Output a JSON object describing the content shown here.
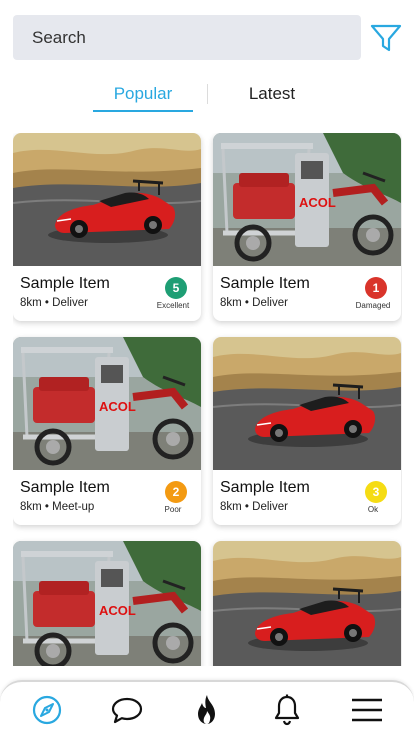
{
  "search": {
    "placeholder": "Search"
  },
  "tabs": [
    {
      "label": "Popular",
      "active": true
    },
    {
      "label": "Latest",
      "active": false
    }
  ],
  "colors": {
    "accent": "#29a8e0",
    "search_bg": "#e6e8ee"
  },
  "items": [
    {
      "title": "Sample Item",
      "subtitle": "8km • Deliver",
      "rating": "5",
      "condition": "Excellent",
      "badge_color": "#1e9e74",
      "image": "car"
    },
    {
      "title": "Sample Item",
      "subtitle": "8km • Deliver",
      "rating": "1",
      "condition": "Damaged",
      "badge_color": "#d9342b",
      "image": "trike"
    },
    {
      "title": "Sample Item",
      "subtitle": "8km • Meet-up",
      "rating": "2",
      "condition": "Poor",
      "badge_color": "#f39a12",
      "image": "trike"
    },
    {
      "title": "Sample Item",
      "subtitle": "8km • Deliver",
      "rating": "3",
      "condition": "Ok",
      "badge_color": "#f5dc14",
      "image": "car"
    },
    {
      "image": "trike"
    },
    {
      "image": "car"
    }
  ],
  "nav": [
    {
      "icon": "compass-icon",
      "active": true
    },
    {
      "icon": "chat-bubble-icon",
      "active": false
    },
    {
      "icon": "flame-icon",
      "active": false
    },
    {
      "icon": "bell-icon",
      "active": false
    },
    {
      "icon": "menu-icon",
      "active": false
    }
  ]
}
